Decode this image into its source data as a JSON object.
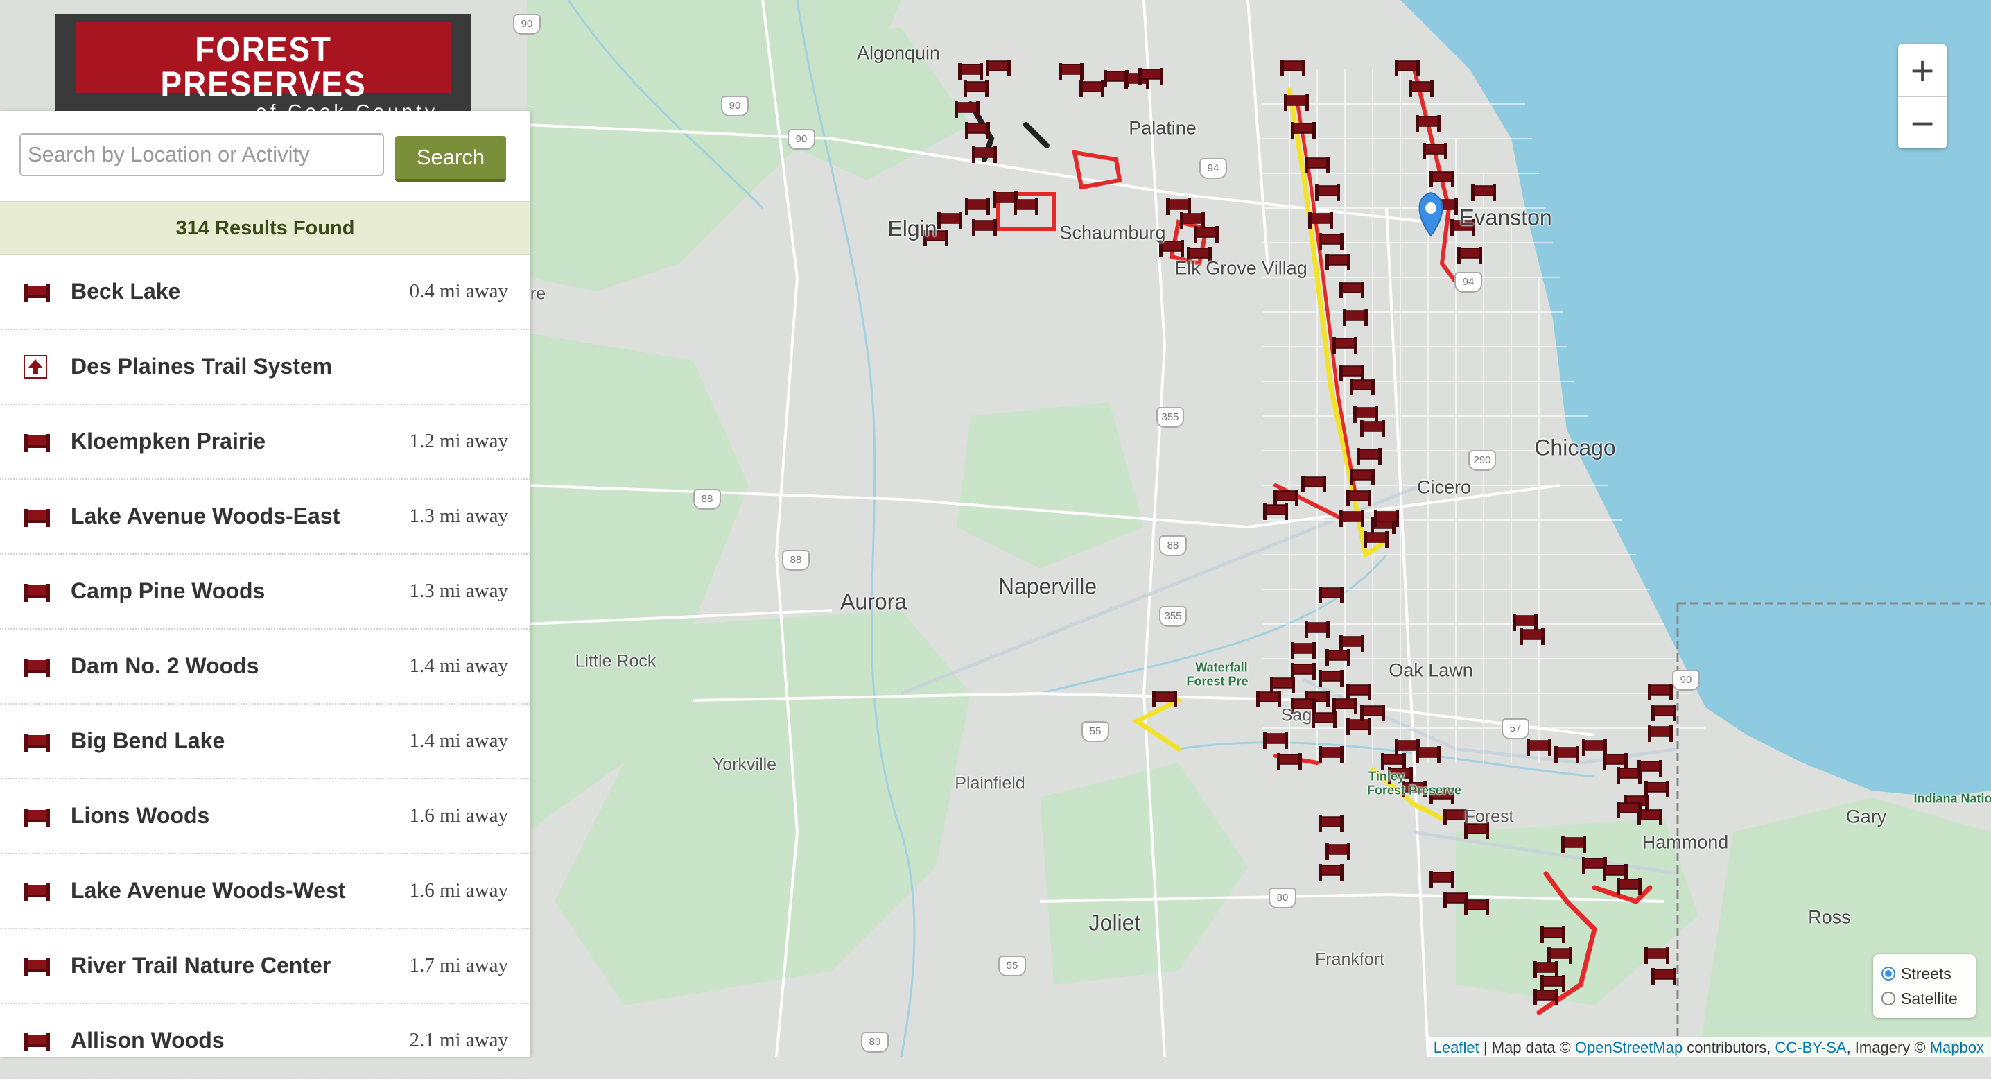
{
  "brand": {
    "title": "FOREST PRESERVES",
    "subtitle": "of Cook County"
  },
  "search": {
    "placeholder": "Search by Location or Activity",
    "button_label": "Search"
  },
  "results": {
    "summary": "314 Results Found",
    "items": [
      {
        "name": "Beck Lake",
        "distance": "0.4 mi away",
        "icon": "bench-icon"
      },
      {
        "name": "Des Plaines Trail System",
        "distance": "",
        "icon": "trail-arrow-icon"
      },
      {
        "name": "Kloempken Prairie",
        "distance": "1.2 mi away",
        "icon": "bench-icon"
      },
      {
        "name": "Lake Avenue Woods-East",
        "distance": "1.3 mi away",
        "icon": "bench-icon"
      },
      {
        "name": "Camp Pine Woods",
        "distance": "1.3 mi away",
        "icon": "bench-icon"
      },
      {
        "name": "Dam No. 2 Woods",
        "distance": "1.4 mi away",
        "icon": "bench-icon"
      },
      {
        "name": "Big Bend Lake",
        "distance": "1.4 mi away",
        "icon": "bench-icon"
      },
      {
        "name": "Lions Woods",
        "distance": "1.6 mi away",
        "icon": "bench-icon"
      },
      {
        "name": "Lake Avenue Woods-West",
        "distance": "1.6 mi away",
        "icon": "bench-icon"
      },
      {
        "name": "River Trail Nature Center",
        "distance": "1.7 mi away",
        "icon": "bench-icon"
      },
      {
        "name": "Allison Woods",
        "distance": "2.1 mi away",
        "icon": "bench-icon"
      }
    ]
  },
  "map": {
    "labels": {
      "algonquin": "Algonquin",
      "palatine": "Palatine",
      "elgin": "Elgin",
      "schaumburg": "Schaumburg",
      "elk_grove": "Elk Grove Villag",
      "evanston": "Evanston",
      "chicago": "Chicago",
      "cicero": "Cicero",
      "aurora": "Aurora",
      "naperville": "Naperville",
      "little_rock": "Little Rock",
      "oak_lawn": "Oak Lawn",
      "yorkville": "Yorkville",
      "plainfield": "Plainfield",
      "joliet": "Joliet",
      "frankfort": "Frankfort",
      "hammond": "Hammond",
      "gary": "Gary",
      "ross": "Ross",
      "tinley": "Tinley",
      "tinley_forest_preserve": "Forest Preserve",
      "waterfall_glen": "Waterfall",
      "waterfall_fp": "Forest Pre",
      "indiana_national": "Indiana National",
      "ore": "re",
      "sag": "Sag",
      "forest_suffix": "Forest"
    },
    "road_shields": [
      "90",
      "90",
      "90",
      "94",
      "355",
      "290",
      "88",
      "88",
      "88",
      "355",
      "55",
      "57",
      "80",
      "80",
      "55",
      "90",
      "94"
    ],
    "layers": {
      "streets": "Streets",
      "satellite": "Satellite",
      "selected": "streets"
    },
    "zoom_in": "+",
    "zoom_out": "−",
    "attribution": {
      "leaflet": "Leaflet",
      "map_data": " | Map data © ",
      "osm": "OpenStreetMap",
      "contributors": " contributors, ",
      "license": "CC-BY-SA",
      "imagery": ", Imagery © ",
      "mapbox": "Mapbox"
    },
    "colors": {
      "water": "#8fcbe0",
      "land": "#dcdfdc",
      "park": "#c3e3c4",
      "marker": "#7a0f15",
      "trail_red": "#e22a2a",
      "trail_yellow": "#f2e32a",
      "pin": "#3b8ee6"
    }
  }
}
